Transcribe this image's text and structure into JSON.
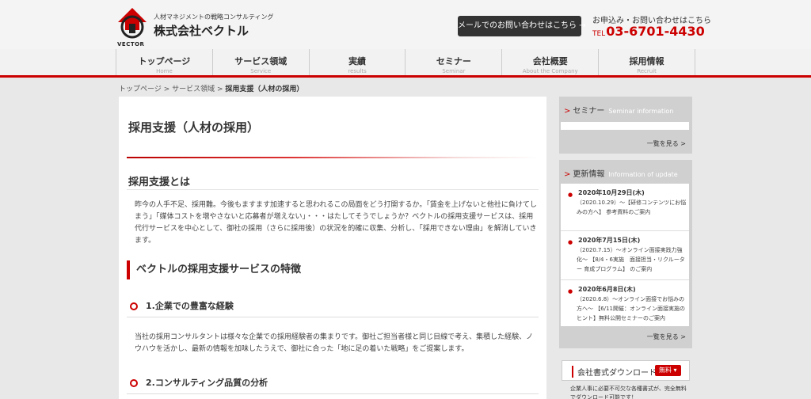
{
  "header": {
    "logo_word": "VECTOR",
    "tagline": "人材マネジメントの戦略コンサルティング",
    "company": "株式会社ベクトル",
    "mail_button": "メールでのお問い合わせはこちら →",
    "contact_caption": "お申込み・お問い合わせはこちら",
    "tel_prefix": "TEL",
    "tel_number": "03-6701-4430"
  },
  "nav": {
    "items": [
      {
        "label": "トップページ",
        "sub": "Home"
      },
      {
        "label": "サービス領域",
        "sub": "Service"
      },
      {
        "label": "実績",
        "sub": "results"
      },
      {
        "label": "セミナー",
        "sub": "Seminar"
      },
      {
        "label": "会社概要",
        "sub": "About the Company"
      },
      {
        "label": "採用情報",
        "sub": "Recruit"
      }
    ]
  },
  "breadcrumb": {
    "home": "トップページ",
    "sep1": " > ",
    "service": "サービス領域",
    "sep2": " > ",
    "current": "採用支援（人材の採用）"
  },
  "main": {
    "title": "採用支援（人材の採用）",
    "section_heading": "採用支援とは",
    "intro": "昨今の人手不足、採用難。今後もますます加速すると思われるこの局面をどう打開するか。「賃金を上げないと他社に負けてしまう」「媒体コストを増やさないと応募者が増えない」・・・はたしてそうでしょうか？ベクトルの採用支援サービスは、採用代行サービスを中心として、御社の採用（さらに採用後）の状況を的確に収集、分析し、「採用できない理由」を解消していきます。",
    "features_heading": "ベクトルの採用支援サービスの特徴",
    "point1_title": "1.企業での豊富な経験",
    "point1_body": "当社の採用コンサルタントは様々な企業での採用経験者の集まりです。御社ご担当者様と同じ目線で考え、集積した経験、ノウハウを活かし、最新の情報を加味したうえで、御社に合った「地に足の着いた戦略」をご提案します。",
    "point2_title": "2.コンサルティング品質の分析"
  },
  "sidebar": {
    "seminar_title": "セミナー",
    "seminar_en": "Seminar information",
    "seminar_more": "一覧を見る >",
    "news_title": "更新情報",
    "news_en": "Information of update",
    "news": [
      {
        "date": "2020年10月29日(木)",
        "text": "（2020.10.29）～【研修コンテンツにお悩みの方へ】 参考資料のご案内"
      },
      {
        "date": "2020年7月15日(木)",
        "text": "（2020.7.15）～オンライン面接実践力強化～ 【8/4・6実施　面接担当・リクルーター 育成プログラム】 のご案内"
      },
      {
        "date": "2020年6月8日(木)",
        "text": "（2020.6.8）～オンライン面接でお悩みの方へ～ 【6/11開催：オンライン面接実施のヒント】無料公開セミナーのご案内"
      }
    ],
    "news_more": "一覧を見る >",
    "download_title": "会社書式ダウンロード",
    "download_badge": "無料 ▾",
    "download_note": "企業人事に必要不可欠な各種書式が、完全無料でダウンロード可能です！"
  },
  "colors": {
    "accent": "#cc0000",
    "mail_button_bg": "#333333",
    "sidebar_bg": "#d0d0d0"
  }
}
